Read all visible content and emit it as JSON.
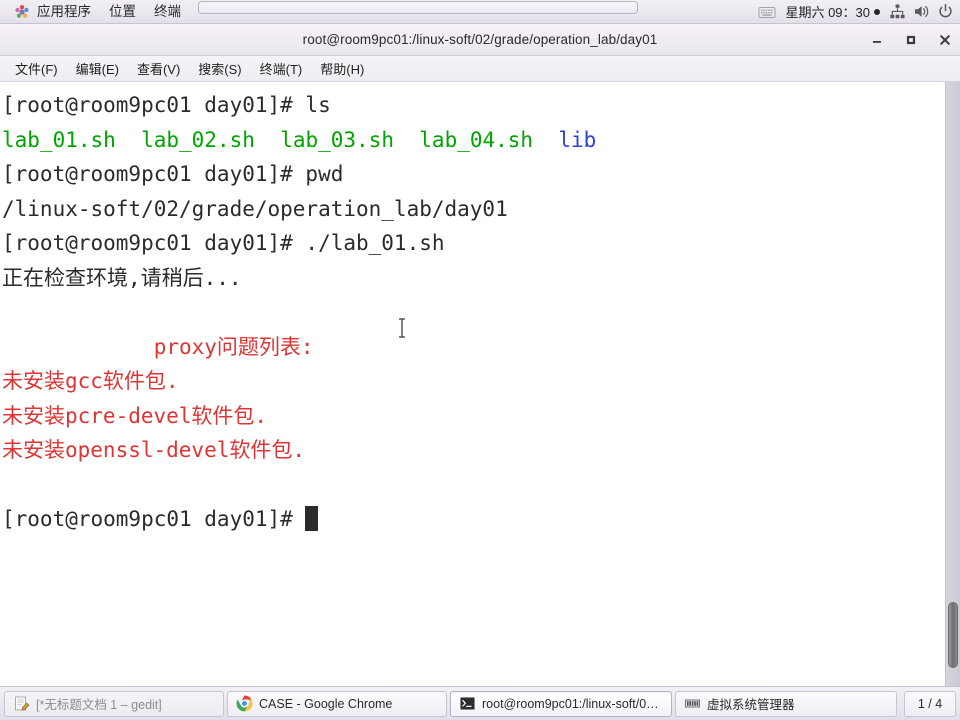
{
  "top_panel": {
    "menus": [
      {
        "label": "应用程序",
        "icon": "applications-starburst-icon"
      },
      {
        "label": "位置",
        "icon": null
      },
      {
        "label": "终端",
        "icon": null
      }
    ],
    "keyboard_icon": "keyboard-icon",
    "clock": "星期六  09：30",
    "recording_indicator": "recording-dot",
    "tray": [
      {
        "icon": "network-icon"
      },
      {
        "icon": "volume-icon"
      },
      {
        "icon": "power-icon"
      }
    ]
  },
  "window": {
    "title": "root@room9pc01:/linux-soft/02/grade/operation_lab/day01",
    "buttons": {
      "minimize": "minimize-icon",
      "maximize": "maximize-icon",
      "close": "close-icon"
    },
    "menubar": [
      "文件(F)",
      "编辑(E)",
      "查看(V)",
      "搜索(S)",
      "终端(T)",
      "帮助(H)"
    ]
  },
  "terminal": {
    "prompt": "[root@room9pc01 day01]# ",
    "lines": [
      {
        "segments": [
          {
            "text": "[root@room9pc01 day01]# ls",
            "color": "default"
          }
        ]
      },
      {
        "segments": [
          {
            "text": "lab_01.sh",
            "color": "green"
          },
          {
            "text": "  ",
            "color": "default"
          },
          {
            "text": "lab_02.sh",
            "color": "green"
          },
          {
            "text": "  ",
            "color": "default"
          },
          {
            "text": "lab_03.sh",
            "color": "green"
          },
          {
            "text": "  ",
            "color": "default"
          },
          {
            "text": "lab_04.sh",
            "color": "green"
          },
          {
            "text": "  ",
            "color": "default"
          },
          {
            "text": "lib",
            "color": "blue"
          }
        ]
      },
      {
        "segments": [
          {
            "text": "[root@room9pc01 day01]# pwd",
            "color": "default"
          }
        ]
      },
      {
        "segments": [
          {
            "text": "/linux-soft/02/grade/operation_lab/day01",
            "color": "default"
          }
        ]
      },
      {
        "segments": [
          {
            "text": "[root@room9pc01 day01]# ./lab_01.sh",
            "color": "default"
          }
        ]
      },
      {
        "segments": [
          {
            "text": "正在检查环境,请稍后...",
            "color": "default"
          }
        ]
      },
      {
        "segments": [
          {
            "text": "",
            "color": "default"
          }
        ]
      },
      {
        "segments": [
          {
            "text": "            proxy问题列表:",
            "color": "red"
          }
        ]
      },
      {
        "segments": [
          {
            "text": "未安装gcc软件包.",
            "color": "red"
          }
        ]
      },
      {
        "segments": [
          {
            "text": "未安装pcre-devel软件包.",
            "color": "red"
          }
        ]
      },
      {
        "segments": [
          {
            "text": "未安装openssl-devel软件包.",
            "color": "red"
          }
        ]
      },
      {
        "segments": [
          {
            "text": "",
            "color": "default"
          }
        ]
      },
      {
        "segments": [
          {
            "text": "[root@room9pc01 day01]# ",
            "color": "default"
          }
        ],
        "cursor": true
      }
    ],
    "colors": {
      "foreground": "#2b2b2b",
      "background": "#ffffff",
      "green": "#00a400",
      "blue": "#2c41d6",
      "red": "#e03434"
    },
    "mouse_cursor": "i-beam-text-cursor"
  },
  "taskbar": {
    "items": [
      {
        "label": "[*无标题文档 1 – gedit]",
        "icon": "gedit-icon",
        "state": "inactive"
      },
      {
        "label": "CASE - Google Chrome",
        "icon": "chrome-icon",
        "state": "normal"
      },
      {
        "label": "root@room9pc01:/linux-soft/0…",
        "icon": "terminal-icon",
        "state": "active"
      },
      {
        "label": "虚拟系统管理器",
        "icon": "virt-manager-icon",
        "state": "normal"
      }
    ],
    "workspace_indicator": "1 / 4"
  }
}
